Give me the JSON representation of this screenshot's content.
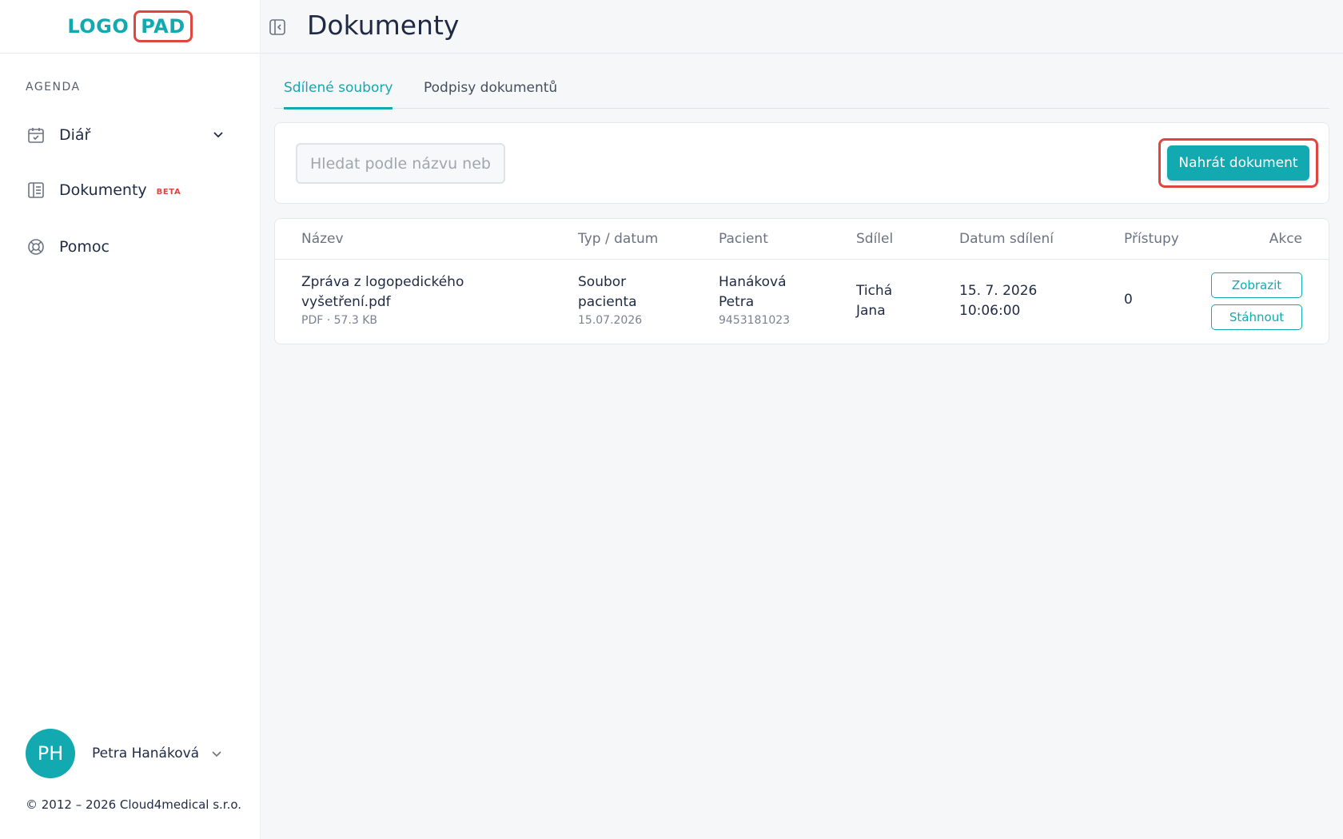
{
  "logo": {
    "part1": "LOGO",
    "part2": "PAD"
  },
  "sidebar": {
    "section_label": "AGENDA",
    "items": [
      {
        "label": "Diář",
        "icon": "calendar-check-icon"
      },
      {
        "label": "Dokumenty",
        "badge": "BETA",
        "icon": "document-list-icon"
      },
      {
        "label": "Pomoc",
        "icon": "lifebuoy-icon"
      }
    ],
    "user": {
      "initials": "PH",
      "name": "Petra Hanáková"
    },
    "copyright": "© 2012 – 2026 Cloud4medical s.r.o."
  },
  "header": {
    "title": "Dokumenty"
  },
  "tabs": [
    {
      "label": "Sdílené soubory",
      "active": true
    },
    {
      "label": "Podpisy dokumentů",
      "active": false
    }
  ],
  "search": {
    "placeholder": "Hledat podle názvu nebo pacienta"
  },
  "upload_button": "Nahrát dokument",
  "table": {
    "headers": [
      "Název",
      "Typ / datum",
      "Pacient",
      "Sdílel",
      "Datum sdílení",
      "Přístupy",
      "Akce"
    ],
    "rows": [
      {
        "name_line1": "Zpráva z logopedického",
        "name_line2": "vyšetření.pdf",
        "meta": "PDF · 57.3 KB",
        "type_line1": "Soubor",
        "type_line2": "pacienta",
        "type_date": "15.07.2026",
        "patient_line1": "Hanáková",
        "patient_line2": "Petra",
        "patient_id": "9453181023",
        "shared_by_line1": "Tichá",
        "shared_by_line2": "Jana",
        "shared_date": "15. 7. 2026",
        "shared_time": "10:06:00",
        "accesses": "0",
        "actions": [
          "Zobrazit",
          "Stáhnout"
        ]
      }
    ]
  },
  "colors": {
    "accent": "#13a9b1",
    "highlight": "#e0453f",
    "text": "#1f2a44"
  }
}
